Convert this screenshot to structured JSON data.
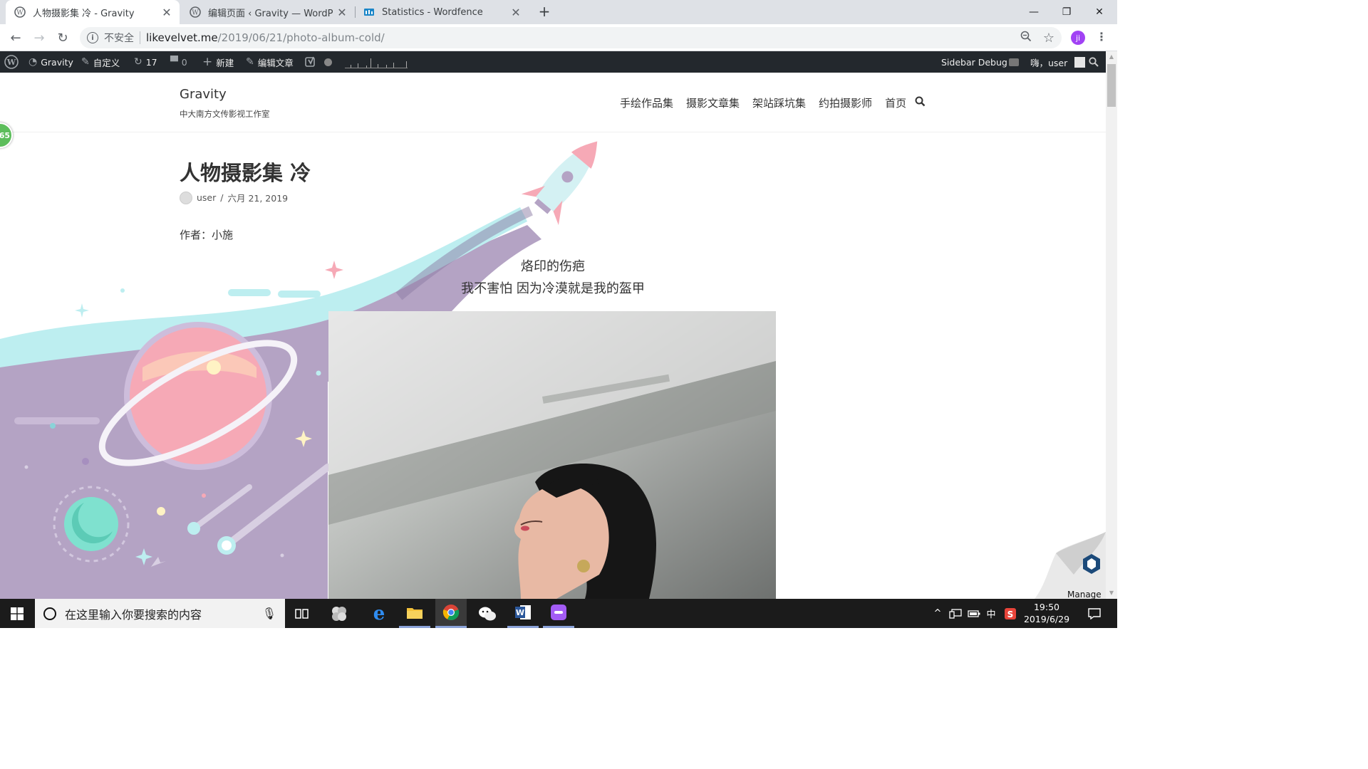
{
  "browser": {
    "tabs": [
      {
        "title": "人物摄影集 冷 - Gravity",
        "active": true
      },
      {
        "title": "编辑页面 ‹ Gravity — WordPress",
        "active": false
      },
      {
        "title": "Statistics - Wordfence",
        "active": false
      }
    ],
    "new_tab_label": "+",
    "security_label": "不安全",
    "url_host": "likevelvet.me",
    "url_path": "/2019/06/21/photo-album-cold/",
    "profile_initial": "ji"
  },
  "adminbar": {
    "site_name": "Gravity",
    "customize": "自定义",
    "updates_count": "17",
    "comments_count": "0",
    "new_label": "新建",
    "edit_post": "编辑文章",
    "sidebar_debug": "Sidebar Debug",
    "greeting": "嗨，user"
  },
  "site": {
    "title": "Gravity",
    "description": "中大南方文传影视工作室",
    "nav": [
      "手绘作品集",
      "摄影文章集",
      "架站踩坑集",
      "约拍摄影师",
      "首页"
    ]
  },
  "post": {
    "title": "人物摄影集 冷",
    "author": "user",
    "date": "六月 21, 2019",
    "author_line": "作者：小施",
    "quote_line1": "烙印的伤疤",
    "quote_line2": "我不害怕 因为冷漠就是我的盔甲"
  },
  "widgets": {
    "wordfence_badge": "65",
    "manage_label": "Manage"
  },
  "taskbar": {
    "search_placeholder": "在这里输入你要搜索的内容",
    "ime_label": "中",
    "time": "19:50",
    "date": "2019/6/29"
  },
  "colors": {
    "adminbar_bg": "#23282d",
    "illustration_purple": "#b4a3c4",
    "illustration_cyan": "#bdeef0",
    "planet_pink": "#f6a9b6",
    "wordfence_green": "#5cbd5b",
    "profile_purple": "#a142f4"
  }
}
